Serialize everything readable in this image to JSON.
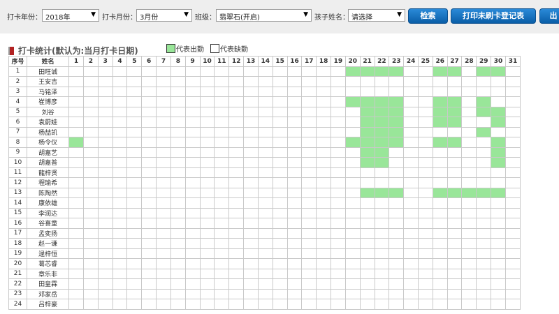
{
  "filters": {
    "year_label": "打卡年份：",
    "year_value": "2018年",
    "month_label": "打卡月份：",
    "month_value": "3月份",
    "class_label": "班级：",
    "class_value": "翡翠石(开启)",
    "child_label": "孩子姓名：",
    "child_value": "请选择"
  },
  "buttons": {
    "search": "检索",
    "print": "打印未刷卡登记表",
    "export": "出"
  },
  "section": {
    "title": "打卡统计(默认为:当月打卡日期)",
    "legend_present": "代表出勤",
    "legend_absent": "代表缺勤"
  },
  "colors": {
    "present": "#99e699",
    "absent": "#ffffff",
    "button": "#1a6fc0"
  },
  "table": {
    "header_index": "序号",
    "header_name": "姓名",
    "days": [
      "1",
      "2",
      "3",
      "4",
      "5",
      "6",
      "7",
      "8",
      "9",
      "10",
      "11",
      "12",
      "13",
      "14",
      "15",
      "16",
      "17",
      "18",
      "19",
      "20",
      "21",
      "22",
      "23",
      "24",
      "25",
      "26",
      "27",
      "28",
      "29",
      "30",
      "31"
    ],
    "rows": [
      {
        "index": "1",
        "name": "田旺诚",
        "present": [
          20,
          21,
          22,
          23,
          26,
          27,
          29,
          30
        ]
      },
      {
        "index": "2",
        "name": "王安吉",
        "present": []
      },
      {
        "index": "3",
        "name": "马铭泽",
        "present": []
      },
      {
        "index": "4",
        "name": "崔博彦",
        "present": [
          20,
          21,
          22,
          23,
          26,
          27,
          29
        ]
      },
      {
        "index": "5",
        "name": "刘谷",
        "present": [
          21,
          22,
          23,
          26,
          27,
          29,
          30
        ]
      },
      {
        "index": "6",
        "name": "袁蔚娃",
        "present": [
          21,
          22,
          23,
          26,
          27,
          30
        ]
      },
      {
        "index": "7",
        "name": "杨喆凯",
        "present": [
          21,
          22,
          23,
          29
        ]
      },
      {
        "index": "8",
        "name": "杨令仪",
        "present": [
          1,
          20,
          21,
          22,
          23,
          26,
          27,
          30
        ]
      },
      {
        "index": "9",
        "name": "胡嘉艺",
        "present": [
          21,
          22,
          30
        ]
      },
      {
        "index": "10",
        "name": "胡嘉普",
        "present": [
          21,
          22,
          30
        ]
      },
      {
        "index": "11",
        "name": "龍梓贤",
        "present": []
      },
      {
        "index": "12",
        "name": "程瑜希",
        "present": []
      },
      {
        "index": "13",
        "name": "陈陶然",
        "present": [
          21,
          22,
          23,
          26,
          27,
          28,
          29,
          30
        ]
      },
      {
        "index": "14",
        "name": "康依雄",
        "present": []
      },
      {
        "index": "15",
        "name": "李润达",
        "present": []
      },
      {
        "index": "16",
        "name": "谷喜童",
        "present": []
      },
      {
        "index": "17",
        "name": "孟奕扬",
        "present": []
      },
      {
        "index": "18",
        "name": "赵一谦",
        "present": []
      },
      {
        "index": "19",
        "name": "逯梓恒",
        "present": []
      },
      {
        "index": "20",
        "name": "葛芯睿",
        "present": []
      },
      {
        "index": "21",
        "name": "章乐非",
        "present": []
      },
      {
        "index": "22",
        "name": "田皇霖",
        "present": []
      },
      {
        "index": "23",
        "name": "邓家岳",
        "present": []
      },
      {
        "index": "24",
        "name": "吕梓豪",
        "present": []
      }
    ]
  }
}
